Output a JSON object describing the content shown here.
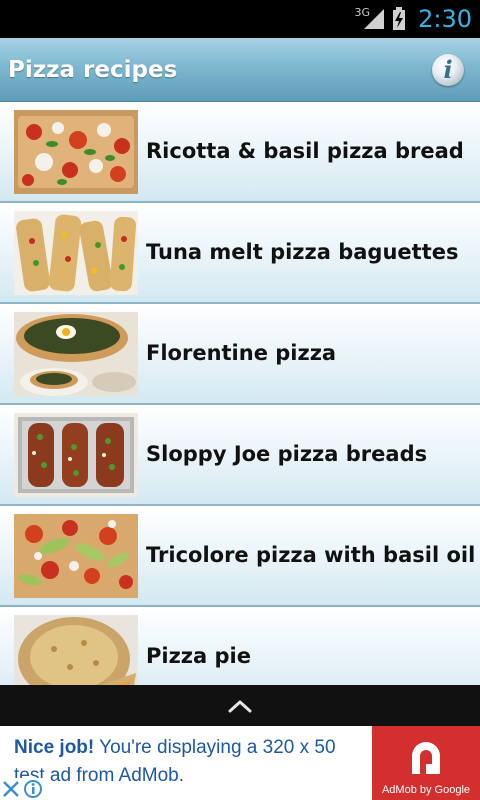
{
  "status_bar": {
    "network": "3G",
    "time": "2:30",
    "time_color": "#33b5e5"
  },
  "action_bar": {
    "title": "Pizza recipes",
    "info_icon": "info-icon"
  },
  "recipes": [
    {
      "name": "Ricotta & basil pizza bread"
    },
    {
      "name": "Tuna melt pizza baguettes"
    },
    {
      "name": "Florentine pizza"
    },
    {
      "name": "Sloppy Joe pizza breads"
    },
    {
      "name": "Tricolore pizza with basil oil"
    },
    {
      "name": "Pizza pie"
    }
  ],
  "toggle_bar": {
    "icon": "chevron-up-icon"
  },
  "ad": {
    "headline": "Nice job!",
    "body": " You're displaying a 320 x 50 test ad from AdMob.",
    "caption": "AdMob by Google",
    "brand_color": "#d32f2f",
    "text_color": "#1e58a8"
  }
}
